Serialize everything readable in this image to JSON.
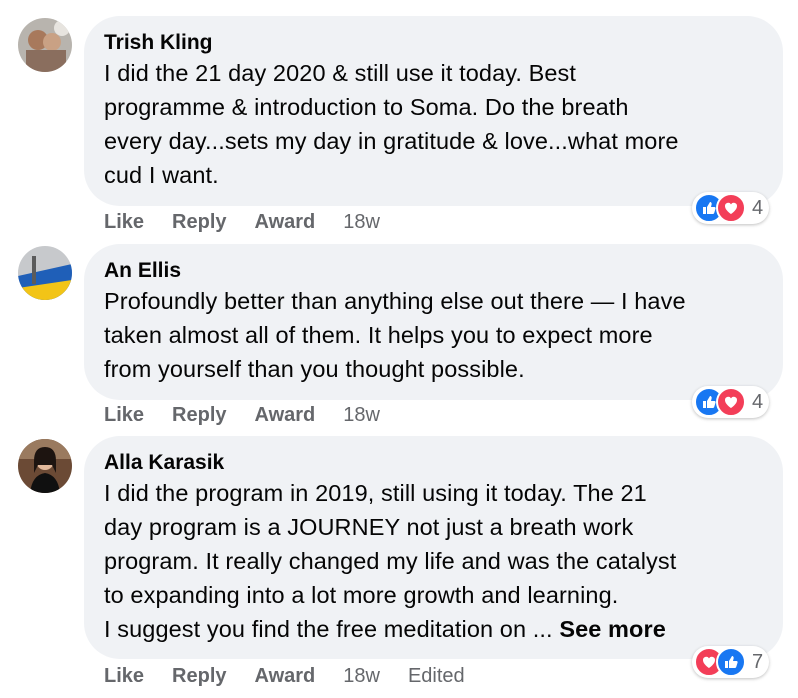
{
  "comments": [
    {
      "author": "Trish Kling",
      "lines": [
        "I did the 21 day 2020 & still use it today. Best",
        "programme & introduction to Soma. Do the breath",
        "every day...sets my day in gratitude & love...what more",
        "cud I want."
      ],
      "actions": {
        "like": "Like",
        "reply": "Reply",
        "award": "Award",
        "time": "18w"
      },
      "reactions": {
        "icons": [
          "like-icon",
          "love-icon"
        ],
        "count": "4"
      }
    },
    {
      "author": "An Ellis",
      "lines": [
        "Profoundly better than anything else out there — I have",
        "taken almost all of them. It helps you to expect more",
        "from yourself than you thought possible."
      ],
      "actions": {
        "like": "Like",
        "reply": "Reply",
        "award": "Award",
        "time": "18w"
      },
      "reactions": {
        "icons": [
          "like-icon",
          "love-icon"
        ],
        "count": "4"
      }
    },
    {
      "author": "Alla Karasik",
      "lines": [
        "I did the program in 2019, still using it today. The 21",
        "day program is a JOURNEY not just a breath work",
        "program. It really changed my life and was the catalyst",
        "to expanding into a lot more growth and learning.",
        "I suggest you find the free meditation on ..."
      ],
      "see_more": "See more",
      "actions": {
        "like": "Like",
        "reply": "Reply",
        "award": "Award",
        "time": "18w",
        "edited": "Edited"
      },
      "reactions": {
        "icons": [
          "love-icon",
          "like-icon"
        ],
        "count": "7"
      }
    }
  ],
  "colors": {
    "bubble": "#f0f2f5",
    "text": "#050505",
    "secondary_text": "#65676b",
    "like_blue": "#1877f2",
    "love_red": "#f33e58"
  }
}
